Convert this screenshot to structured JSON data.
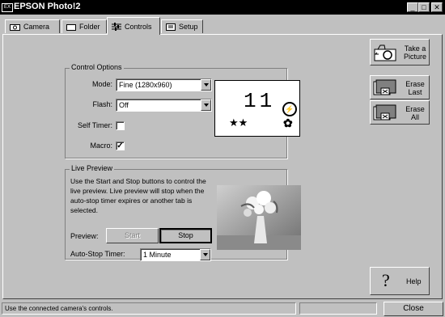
{
  "window": {
    "title": "EPSON Photo!2",
    "icon_label": "EX"
  },
  "title_buttons": {
    "minimize": "_",
    "maximize": "□",
    "close": "✕"
  },
  "tabs": [
    {
      "label": "Camera",
      "icon": "camera-icon"
    },
    {
      "label": "Folder",
      "icon": "folder-icon"
    },
    {
      "label": "Controls",
      "icon": "sliders-icon"
    },
    {
      "label": "Setup",
      "icon": "setup-icon"
    }
  ],
  "control_options": {
    "legend": "Control Options",
    "mode_label": "Mode:",
    "mode_value": "Fine (1280x960)",
    "flash_label": "Flash:",
    "flash_value": "Off",
    "self_timer_label": "Self Timer:",
    "self_timer_checked": false,
    "macro_label": "Macro:",
    "macro_checked": true,
    "macro_mark": "✓",
    "lcd_count": "11",
    "lcd_quality": "★★",
    "lcd_flash": "⚡",
    "lcd_macro": "✿"
  },
  "live_preview": {
    "legend": "Live Preview",
    "description": "Use the Start and Stop buttons to control the live preview.  Live preview will stop when the auto-stop timer expires or another tab is selected.",
    "preview_label": "Preview:",
    "start_label": "Start",
    "stop_label": "Stop",
    "timer_label": "Auto-Stop Timer:",
    "timer_value": "1 Minute"
  },
  "side_buttons": {
    "take_picture": "Take a Picture",
    "erase_last": "Erase Last",
    "erase_all": "Erase All",
    "help": "Help",
    "help_glyph": "?"
  },
  "status_bar": {
    "text": "Use the connected camera's controls.",
    "close_label": "Close"
  },
  "colors": {
    "face": "#c0c0c0",
    "title_bar": "#000000",
    "lcd": "#ffffff"
  }
}
